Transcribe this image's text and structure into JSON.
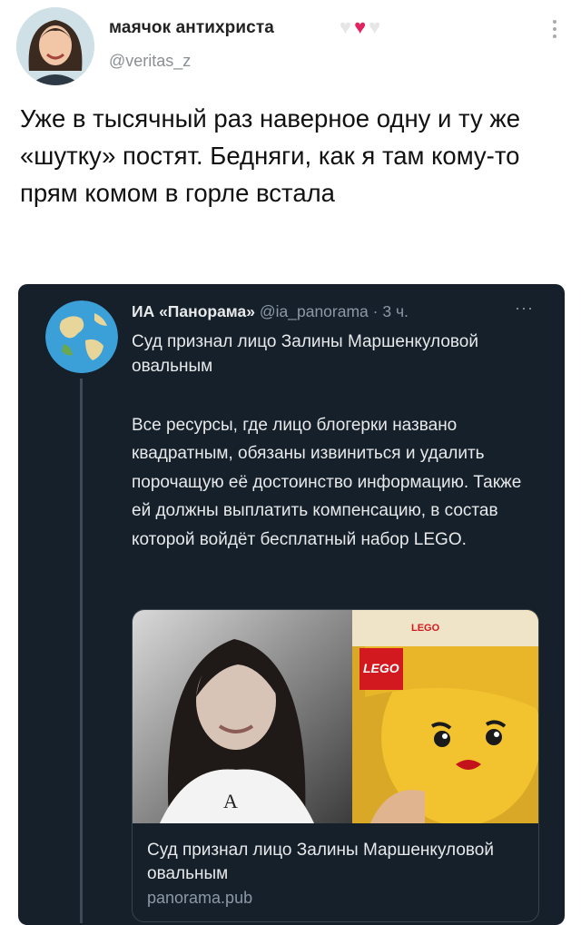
{
  "author": {
    "display_name": "маячок антихриста",
    "handle": "@veritas_z",
    "hearts": [
      "🤍",
      "❤️",
      "🤍"
    ]
  },
  "tweet": {
    "text": "Уже в тысячный раз наверное одну и ту же «шутку» постят. Бедняги, как я там кому-то прям комом в горле встала"
  },
  "quoted": {
    "name": "ИА «Панорама»",
    "handle": "@ia_panorama",
    "time": "· 3 ч.",
    "more": "···",
    "title": "Суд признал лицо Залины Маршенкуловой овальным",
    "body": "Все ресурсы, где лицо блогерки названо квадратным, обязаны извиниться и удалить порочащую её достоинство информацию. Также ей должны выплатить компенсацию, в состав которой войдёт бесплатный набор LEGO.",
    "card": {
      "title": "Суд признал лицо Залины Маршенкуловой овальным",
      "domain": "panorama.pub",
      "shirt_letter": "A",
      "logo_top": "LEGO",
      "logo_box": "LEGO"
    }
  },
  "colors": {
    "quote_bg": "#15202b",
    "lego_yellow": "#e2bb35",
    "heart_red": "#e0245e"
  }
}
